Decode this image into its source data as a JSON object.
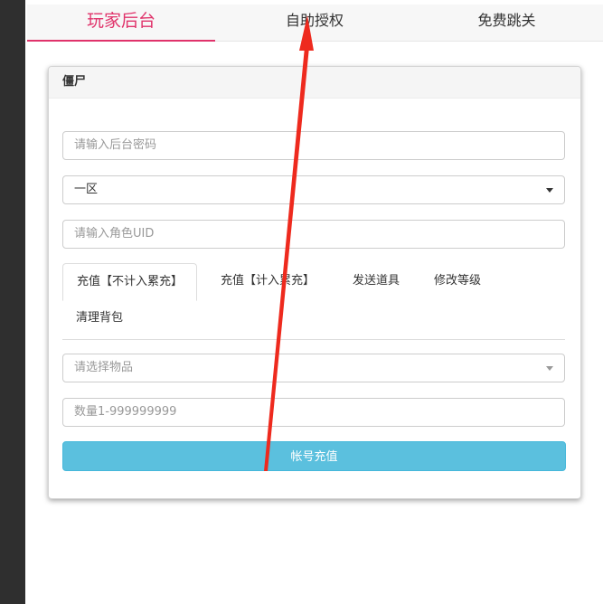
{
  "top_tabs": [
    {
      "label": "玩家后台",
      "active": true
    },
    {
      "label": "自助授权",
      "active": false
    },
    {
      "label": "免费跳关",
      "active": false
    }
  ],
  "panel": {
    "title": "僵尸",
    "password_placeholder": "请输入后台密码",
    "server_value": "一区",
    "uid_placeholder": "请输入角色UID",
    "sub_tabs": [
      {
        "label": "充值【不计入累充】",
        "active": true
      },
      {
        "label": "充值【计入累充】",
        "active": false
      },
      {
        "label": "发送道具",
        "active": false
      },
      {
        "label": "修改等级",
        "active": false
      },
      {
        "label": "清理背包",
        "active": false
      }
    ],
    "item_placeholder": "请选择物品",
    "quantity_placeholder": "数量1-999999999",
    "submit_label": "帐号充值"
  },
  "colors": {
    "accent": "#e0336b",
    "button": "#5bc0de",
    "annotation_arrow": "#ee2a1e",
    "sidebar": "#2f2f2f"
  },
  "annotation": {
    "icon": "red-arrow-icon"
  }
}
